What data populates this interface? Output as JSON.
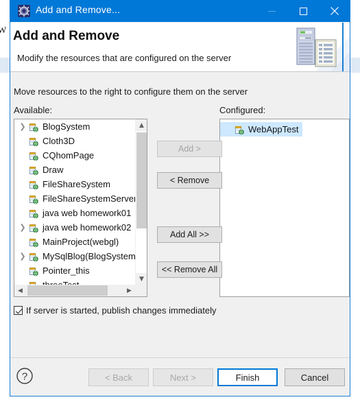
{
  "window": {
    "title": "Add and Remove...",
    "icon": "gear-icon",
    "minimize_label": "Minimize",
    "maximize_label": "Maximize",
    "close_label": "Close",
    "accent_color": "#0078d7"
  },
  "header": {
    "title": "Add and Remove",
    "subtitle": "Modify the resources that are configured on the server",
    "banner_icon": "server-and-document-icon"
  },
  "body": {
    "instruction": "Move resources to the right to configure them on the server",
    "available_label": "Available:",
    "configured_label": "Configured:"
  },
  "available_list": {
    "items": [
      {
        "label": "BlogSystem",
        "expandable": true,
        "icon": "web-project-icon"
      },
      {
        "label": "Cloth3D",
        "expandable": false,
        "icon": "web-project-icon"
      },
      {
        "label": "CQhomPage",
        "expandable": false,
        "icon": "web-project-icon"
      },
      {
        "label": "Draw",
        "expandable": false,
        "icon": "web-project-icon"
      },
      {
        "label": "FileShareSystem",
        "expandable": false,
        "icon": "web-project-icon"
      },
      {
        "label": "FileShareSystemServer",
        "expandable": false,
        "icon": "web-project-icon"
      },
      {
        "label": "java web homework01",
        "expandable": false,
        "icon": "web-project-icon"
      },
      {
        "label": "java web homework02",
        "expandable": true,
        "icon": "web-project-icon"
      },
      {
        "label": "MainProject(webgl)",
        "expandable": false,
        "icon": "web-project-icon"
      },
      {
        "label": "MySqlBlog(BlogSystem)",
        "expandable": true,
        "icon": "web-project-icon"
      },
      {
        "label": "Pointer_this",
        "expandable": false,
        "icon": "web-project-icon"
      },
      {
        "label": "threeTest",
        "expandable": false,
        "icon": "web-project-icon"
      }
    ]
  },
  "configured_list": {
    "items": [
      {
        "label": "WebAppTest",
        "selected": true,
        "icon": "web-project-icon"
      }
    ]
  },
  "transfer_buttons": {
    "add": {
      "label": "Add >",
      "enabled": false
    },
    "remove": {
      "label": "< Remove",
      "enabled": true
    },
    "add_all": {
      "label": "Add All >>",
      "enabled": true
    },
    "remove_all": {
      "label": "<< Remove All",
      "enabled": true
    }
  },
  "options": {
    "publish_immediately": {
      "label": "If server is started, publish changes immediately",
      "checked": true
    }
  },
  "footer": {
    "help": {
      "label": "?"
    },
    "back": {
      "label": "< Back",
      "enabled": false
    },
    "next": {
      "label": "Next >",
      "enabled": false
    },
    "finish": {
      "label": "Finish",
      "enabled": true,
      "default": true
    },
    "cancel": {
      "label": "Cancel",
      "enabled": true
    }
  }
}
